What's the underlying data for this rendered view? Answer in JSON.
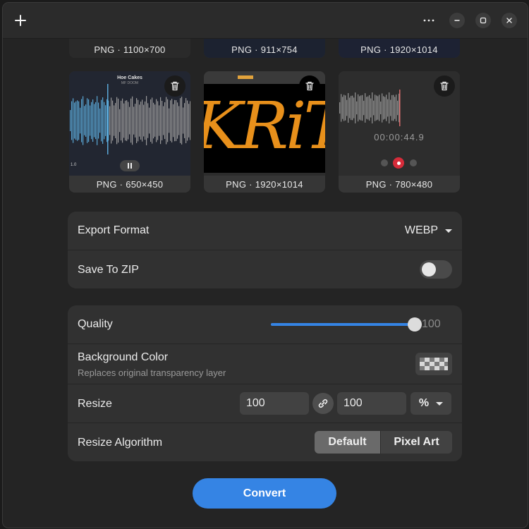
{
  "header": {
    "add_icon": "plus-icon",
    "menu_icon": "more-horizontal-icon",
    "minimize_icon": "minimize-icon",
    "maximize_icon": "maximize-icon",
    "close_icon": "close-icon"
  },
  "images": [
    {
      "label": "PNG · 1100×700"
    },
    {
      "label": "PNG · 911×754"
    },
    {
      "label": "PNG · 1920×1014"
    },
    {
      "label": "PNG · 650×450",
      "title": "Hoe Cakes",
      "subtitle": "MF DOOM",
      "time": "1.0"
    },
    {
      "label": "PNG · 1920×1014",
      "text": "KRiTA!"
    },
    {
      "label": "PNG · 780×480",
      "time": "00:00:44.9"
    }
  ],
  "export": {
    "format_label": "Export Format",
    "format_value": "WEBP",
    "zip_label": "Save To ZIP",
    "zip_enabled": false
  },
  "options": {
    "quality_label": "Quality",
    "quality_value": 100,
    "quality_text": "100",
    "bg_label": "Background Color",
    "bg_sub": "Replaces original transparency layer",
    "resize_label": "Resize",
    "resize_width": "100",
    "resize_height": "100",
    "resize_unit": "%",
    "algo_label": "Resize Algorithm",
    "algo_default": "Default",
    "algo_pixel": "Pixel Art"
  },
  "convert_label": "Convert",
  "colors": {
    "accent": "#3584e4",
    "window_bg": "#242424",
    "row_bg": "#313131"
  }
}
